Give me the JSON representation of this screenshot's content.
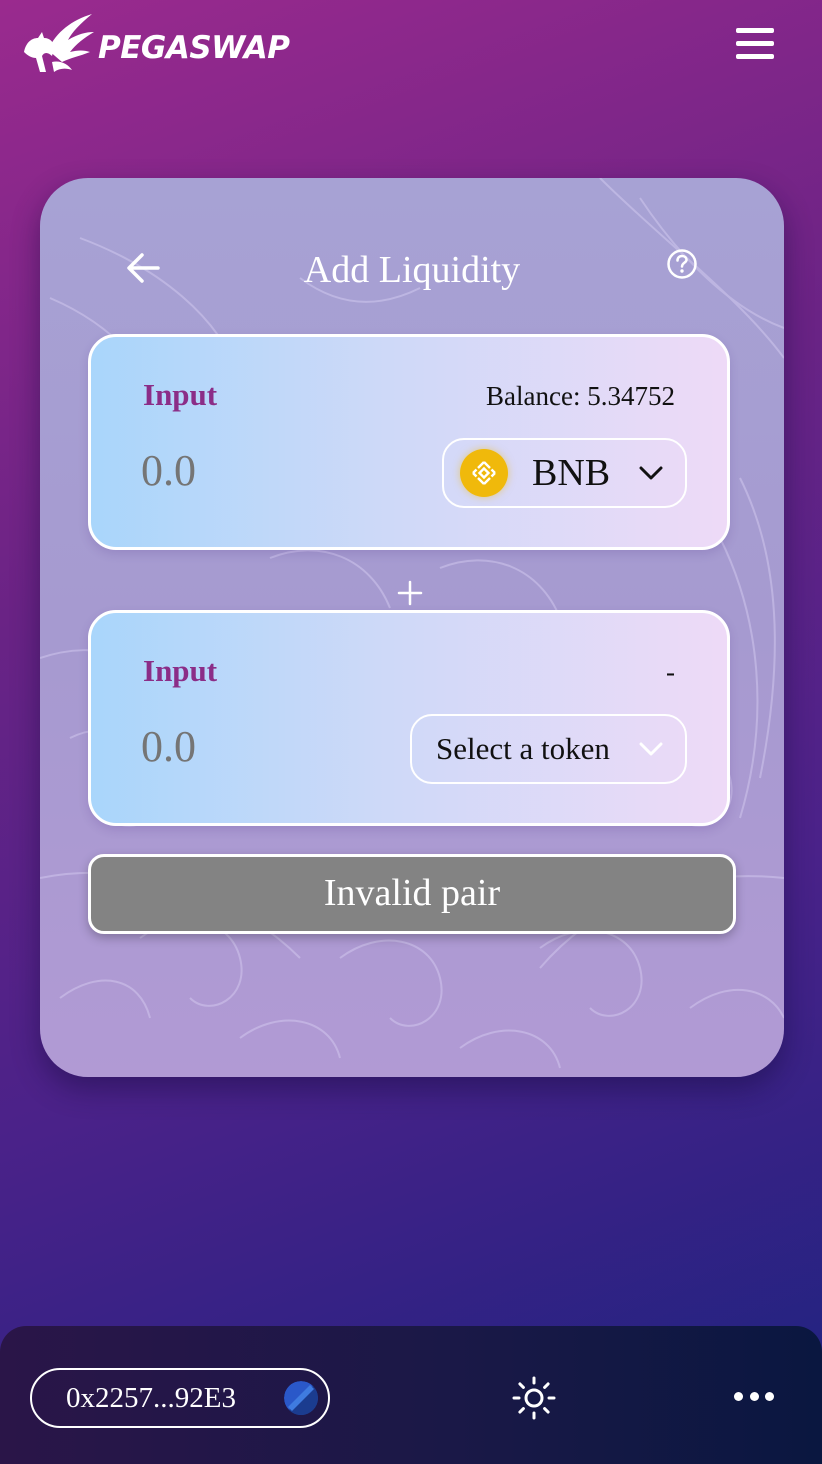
{
  "header": {
    "brand": "PEGASWAP"
  },
  "card": {
    "title": "Add Liquidity"
  },
  "input_a": {
    "label": "Input",
    "balance": "Balance: 5.34752",
    "amount_placeholder": "0.0",
    "token": "BNB"
  },
  "input_b": {
    "label": "Input",
    "balance": "-",
    "amount_placeholder": "0.0",
    "token": "Select a token"
  },
  "action": {
    "label": "Invalid pair"
  },
  "footer": {
    "wallet_address": "0x2257...92E3"
  },
  "icons": {
    "back": "arrow-left-icon",
    "help": "question-circle-icon",
    "menu": "hamburger-icon",
    "plus": "plus-icon",
    "theme": "sun-icon",
    "more": "more-dots-icon"
  },
  "colors": {
    "label": "#8b2d87",
    "bnb": "#f0b90b",
    "invalid_button": "#838383"
  }
}
